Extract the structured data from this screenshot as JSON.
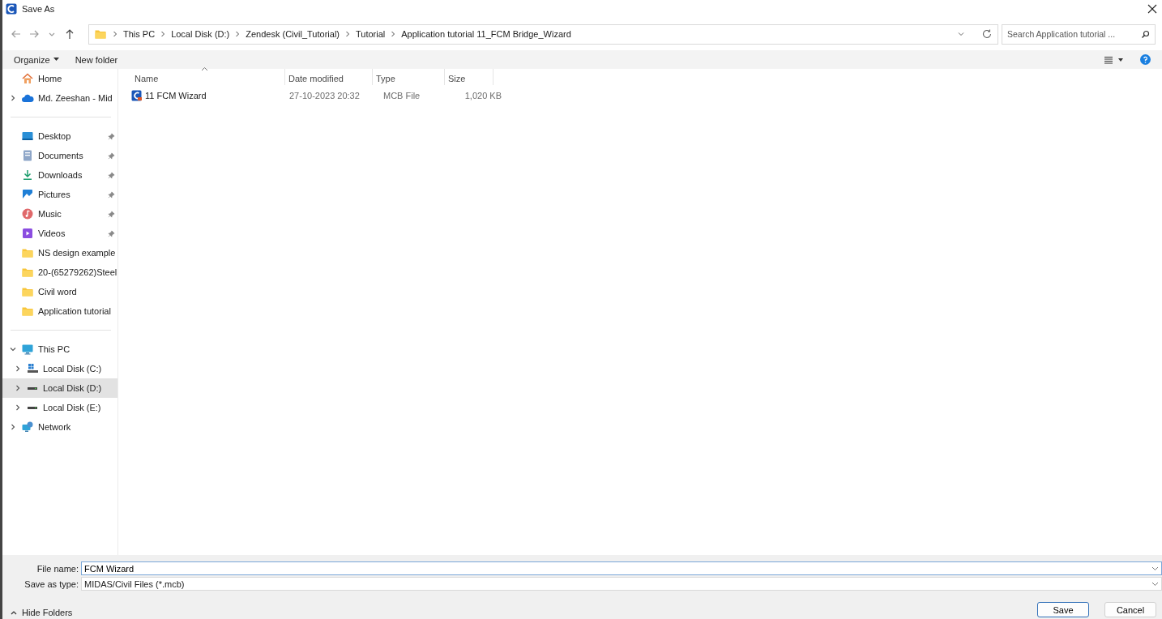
{
  "window": {
    "title": "Save As"
  },
  "address": {
    "crumbs": [
      "This PC",
      "Local Disk (D:)",
      "Zendesk (Civil_Tutorial)",
      "Tutorial",
      "Application tutorial 11_FCM Bridge_Wizard"
    ]
  },
  "search": {
    "placeholder": "Search Application tutorial ..."
  },
  "toolbar": {
    "organize": "Organize",
    "new_folder": "New folder"
  },
  "sidebar": {
    "groups": [
      {
        "items": [
          {
            "label": "Home",
            "kind": "home",
            "selected": false
          },
          {
            "label": "Md. Zeeshan - Mid",
            "kind": "cloud",
            "expanded": false,
            "selected": false
          }
        ]
      },
      {
        "items": [
          {
            "label": "Desktop",
            "kind": "desktop",
            "pinned": true,
            "selected": false
          },
          {
            "label": "Documents",
            "kind": "documents",
            "pinned": true,
            "selected": false
          },
          {
            "label": "Downloads",
            "kind": "downloads",
            "pinned": true,
            "selected": false
          },
          {
            "label": "Pictures",
            "kind": "pictures",
            "pinned": true,
            "selected": false
          },
          {
            "label": "Music",
            "kind": "music",
            "pinned": true,
            "selected": false
          },
          {
            "label": "Videos",
            "kind": "videos",
            "pinned": true,
            "selected": false
          },
          {
            "label": "NS design example",
            "kind": "folder",
            "pinned": false,
            "selected": false
          },
          {
            "label": "20-(65279262)Steel",
            "kind": "folder",
            "pinned": false,
            "selected": false
          },
          {
            "label": "Civil word",
            "kind": "folder",
            "pinned": false,
            "selected": false
          },
          {
            "label": "Application tutorial",
            "kind": "folder",
            "pinned": false,
            "selected": false
          }
        ]
      },
      {
        "items": [
          {
            "label": "This PC",
            "kind": "pc",
            "expanded": true,
            "selected": false,
            "children": [
              {
                "label": "Local Disk (C:)",
                "kind": "drive-system",
                "expanded": false,
                "selected": false
              },
              {
                "label": "Local Disk (D:)",
                "kind": "drive",
                "expanded": false,
                "selected": true
              },
              {
                "label": "Local Disk (E:)",
                "kind": "drive",
                "expanded": false,
                "selected": false
              }
            ]
          },
          {
            "label": "Network",
            "kind": "network",
            "expanded": false,
            "selected": false
          }
        ]
      }
    ]
  },
  "table": {
    "columns": [
      {
        "label": "Name",
        "sorted": true
      },
      {
        "label": "Date modified",
        "sorted": false
      },
      {
        "label": "Type",
        "sorted": false
      },
      {
        "label": "Size",
        "sorted": false
      }
    ],
    "rows": [
      {
        "name": "11 FCM Wizard",
        "date": "27-10-2023 20:32",
        "type": "MCB File",
        "size": "1,020 KB",
        "selected": false
      }
    ]
  },
  "form": {
    "file_name": {
      "label": "File name:",
      "value": "FCM Wizard"
    },
    "save_type": {
      "label": "Save as type:",
      "value": "MIDAS/Civil Files (*.mcb)"
    }
  },
  "footer": {
    "hide_folders": "Hide Folders",
    "buttons": [
      {
        "label": "Save",
        "kind": "default"
      },
      {
        "label": "Cancel",
        "kind": "normal"
      }
    ]
  }
}
